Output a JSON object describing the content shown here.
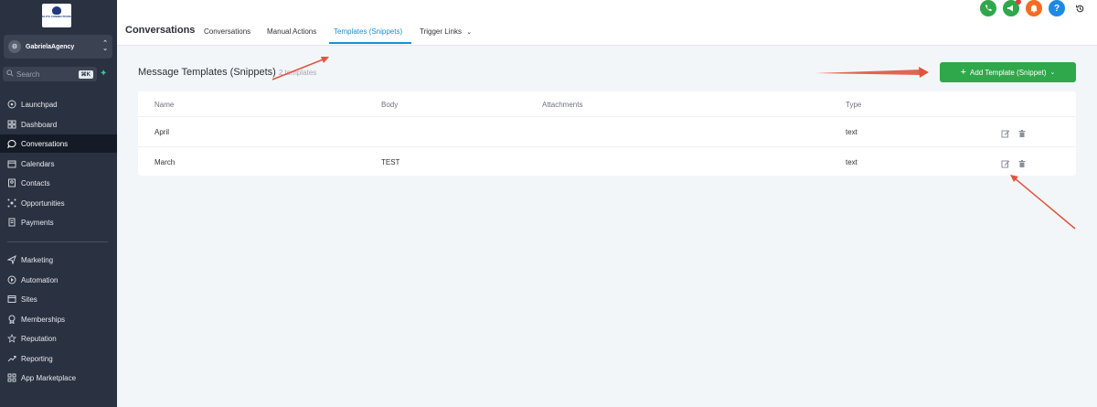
{
  "app": {
    "logo_label": "ELITE CONNECTIONS",
    "account_name": "GabrielaAgency"
  },
  "search": {
    "placeholder": "Search",
    "shortcut": "⌘K"
  },
  "sidebar": {
    "items": [
      {
        "label": "Launchpad",
        "icon": "rocket-icon"
      },
      {
        "label": "Dashboard",
        "icon": "grid-icon"
      },
      {
        "label": "Conversations",
        "icon": "chat-icon",
        "active": true
      },
      {
        "label": "Calendars",
        "icon": "calendar-icon"
      },
      {
        "label": "Contacts",
        "icon": "contacts-icon"
      },
      {
        "label": "Opportunities",
        "icon": "opportunities-icon"
      },
      {
        "label": "Payments",
        "icon": "payments-icon"
      },
      {
        "label": "Marketing",
        "icon": "send-icon"
      },
      {
        "label": "Automation",
        "icon": "automation-icon"
      },
      {
        "label": "Sites",
        "icon": "sites-icon"
      },
      {
        "label": "Memberships",
        "icon": "membership-icon"
      },
      {
        "label": "Reputation",
        "icon": "star-icon"
      },
      {
        "label": "Reporting",
        "icon": "chart-icon"
      },
      {
        "label": "App Marketplace",
        "icon": "apps-icon"
      }
    ]
  },
  "header": {
    "title": "Conversations",
    "tabs": [
      {
        "label": "Conversations"
      },
      {
        "label": "Manual Actions"
      },
      {
        "label": "Templates (Snippets)",
        "active": true
      },
      {
        "label": "Trigger Links"
      }
    ],
    "icons": [
      "phone-icon",
      "megaphone-icon",
      "bell-icon",
      "help-icon",
      "history-icon"
    ],
    "colors": {
      "phone": "#2ea84a",
      "megaphone": "#2ea84a",
      "bell": "#f26b21",
      "help": "#1e88e5"
    }
  },
  "main": {
    "title": "Message Templates (Snippets)",
    "count": "2 templates",
    "add_button": "Add Template (Snippet)",
    "columns": [
      "Name",
      "Body",
      "Attachments",
      "Type"
    ],
    "rows": [
      {
        "name": "April",
        "body": "",
        "attachments": "",
        "type": "text"
      },
      {
        "name": "March",
        "body": "TEST",
        "attachments": "",
        "type": "text"
      }
    ]
  },
  "colors": {
    "accent": "#1a8fd6",
    "primary_button": "#2ea84a",
    "sidebar_bg": "#2a3140",
    "annotation_arrow": "#e0553d"
  }
}
